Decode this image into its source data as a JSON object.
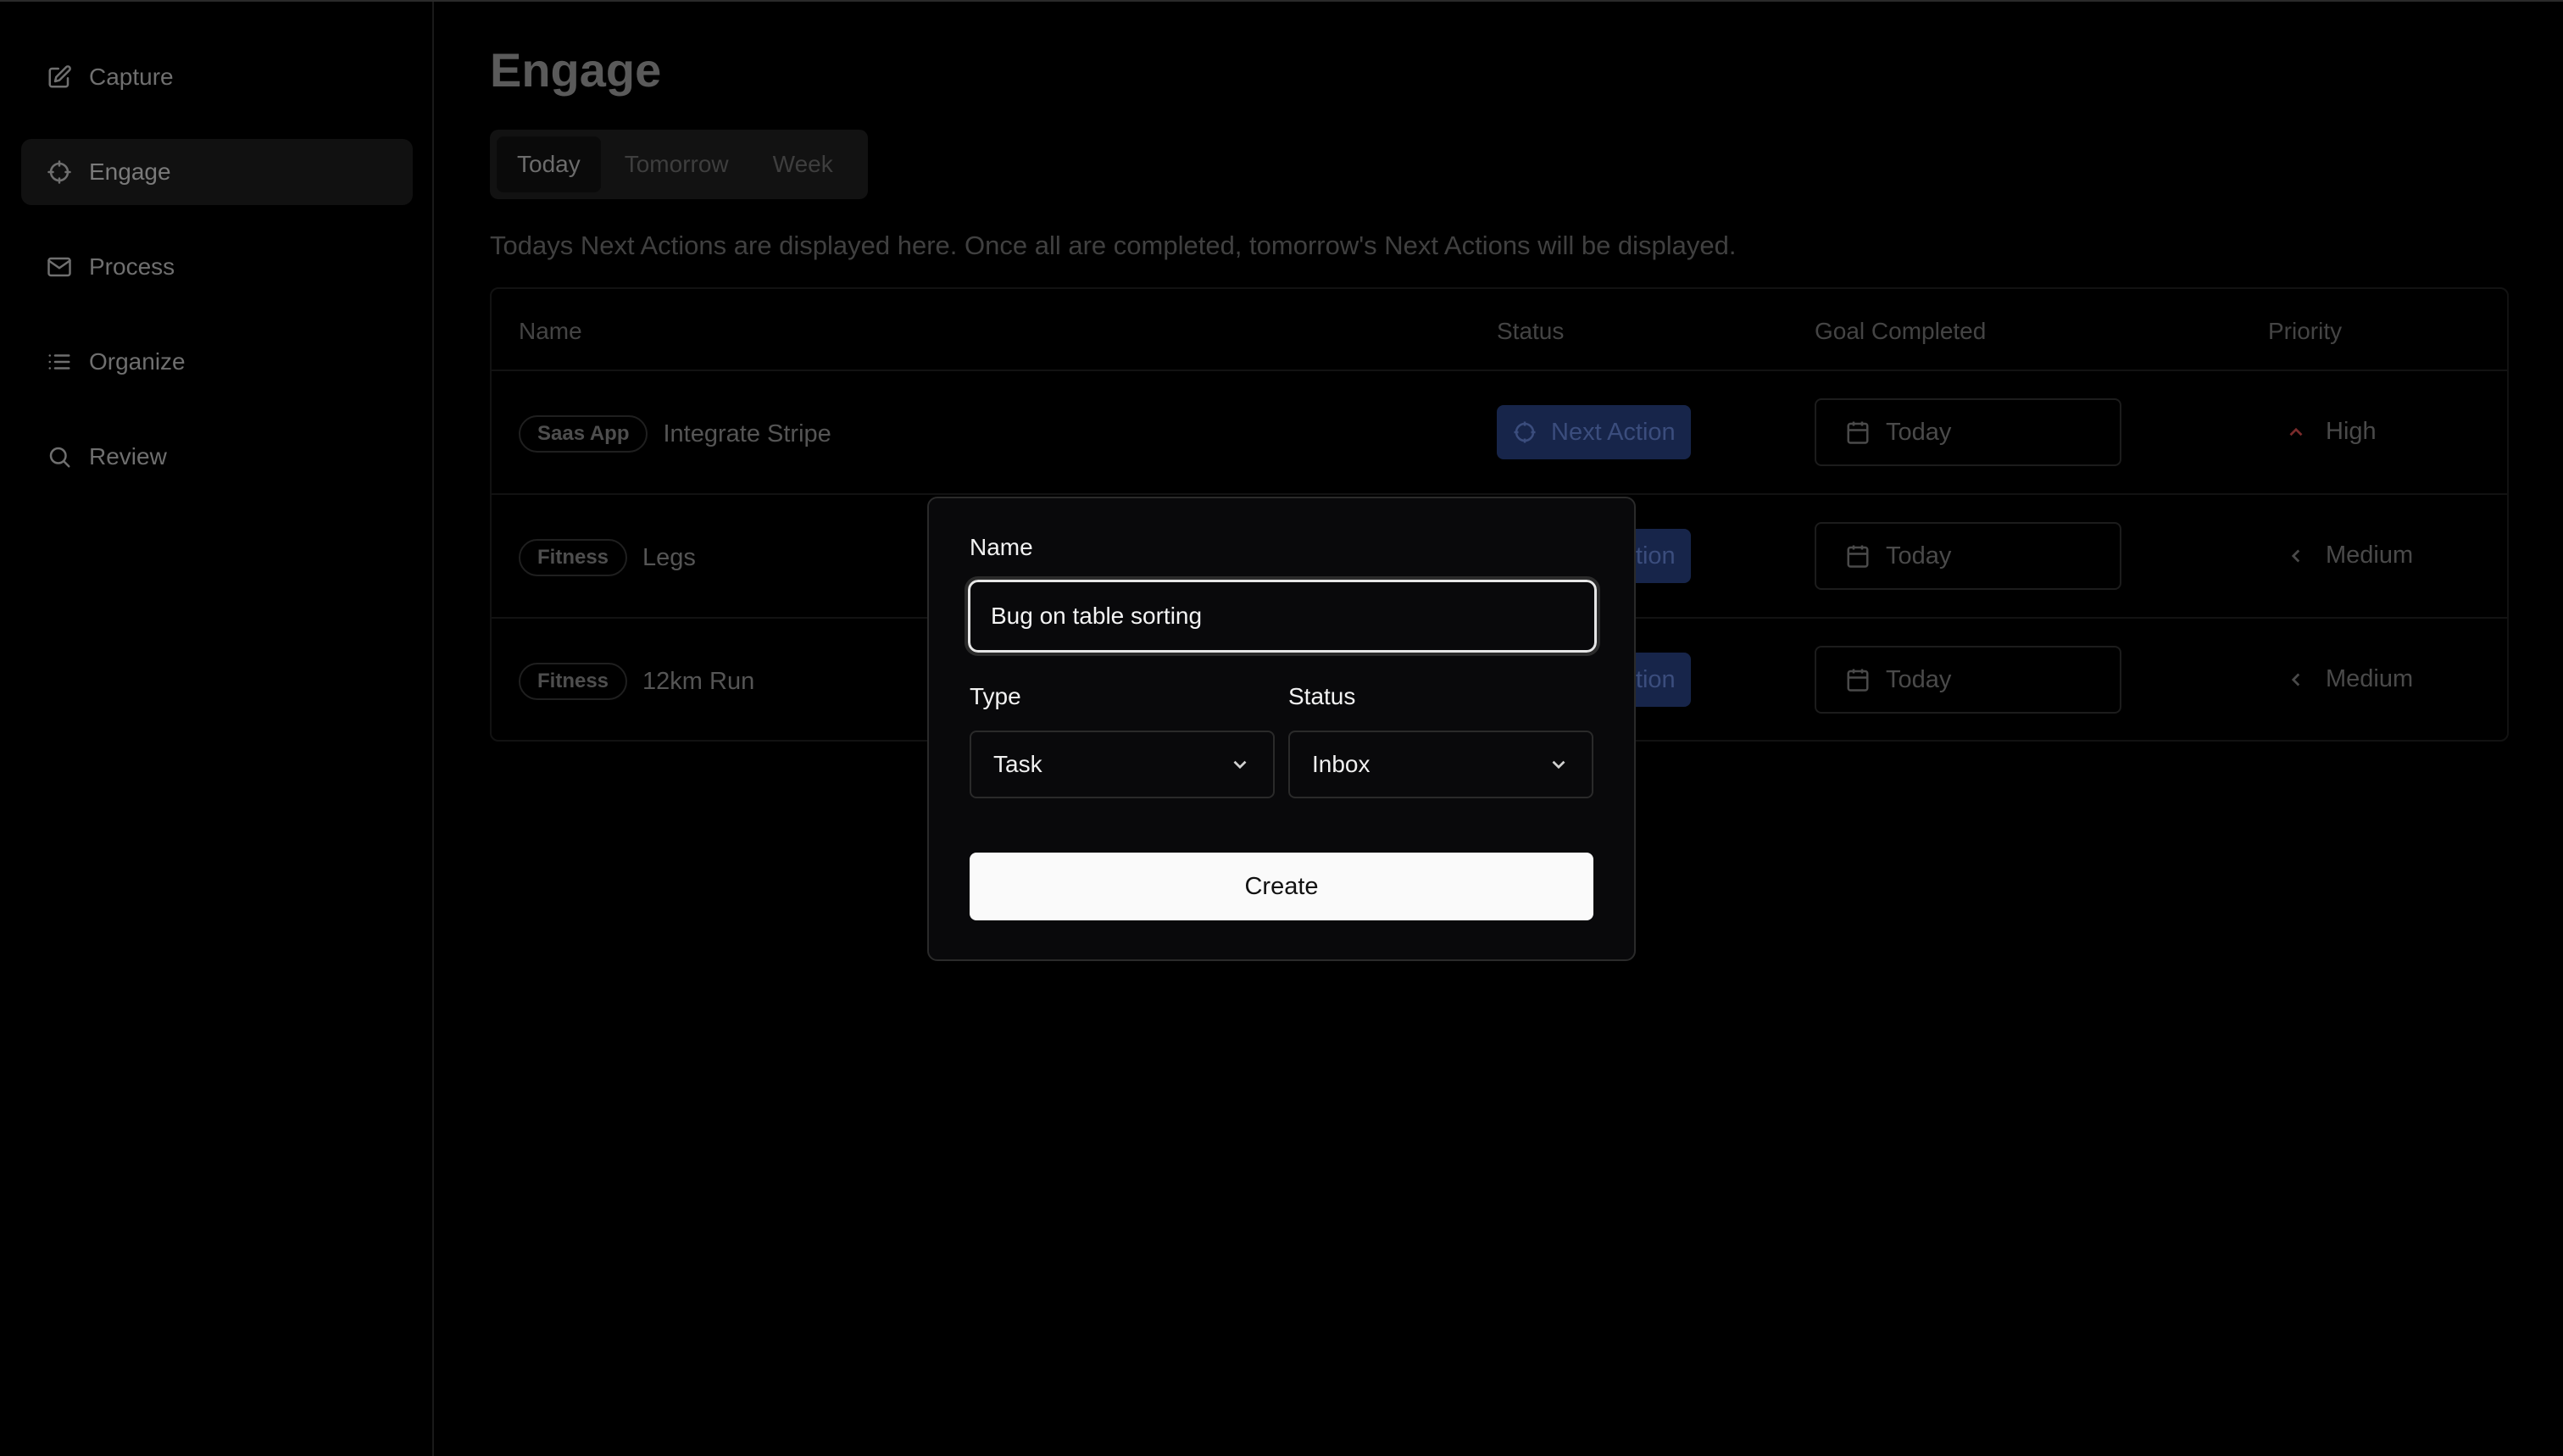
{
  "sidebar": {
    "items": [
      {
        "label": "Capture",
        "icon": "edit-icon"
      },
      {
        "label": "Engage",
        "icon": "crosshair-icon",
        "active": true
      },
      {
        "label": "Process",
        "icon": "mail-icon"
      },
      {
        "label": "Organize",
        "icon": "list-icon"
      },
      {
        "label": "Review",
        "icon": "search-icon"
      }
    ]
  },
  "main": {
    "title": "Engage",
    "tabs": [
      {
        "label": "Today",
        "active": true
      },
      {
        "label": "Tomorrow"
      },
      {
        "label": "Week"
      }
    ],
    "description": "Todays Next Actions are displayed here. Once all are completed, tomorrow's Next Actions will be displayed."
  },
  "table": {
    "headers": [
      "Name",
      "Status",
      "Goal Completed",
      "Priority"
    ],
    "rows": [
      {
        "tag": "Saas App",
        "name": "Integrate Stripe",
        "status": "Next Action",
        "goal": "Today",
        "priority": "High"
      },
      {
        "tag": "Fitness",
        "name": "Legs",
        "status": "Next Action",
        "goal": "Today",
        "priority": "Medium"
      },
      {
        "tag": "Fitness",
        "name": "12km Run",
        "status": "Next Action",
        "goal": "Today",
        "priority": "Medium"
      }
    ]
  },
  "dialog": {
    "name_label": "Name",
    "name_value": "Bug on table sorting",
    "type_label": "Type",
    "type_value": "Task",
    "status_label": "Status",
    "status_value": "Inbox",
    "create_label": "Create"
  },
  "colors": {
    "background": "#000000",
    "status_pill": "#17254a",
    "high_priority": "#7a2b2b",
    "create_button": "#fafafa"
  }
}
